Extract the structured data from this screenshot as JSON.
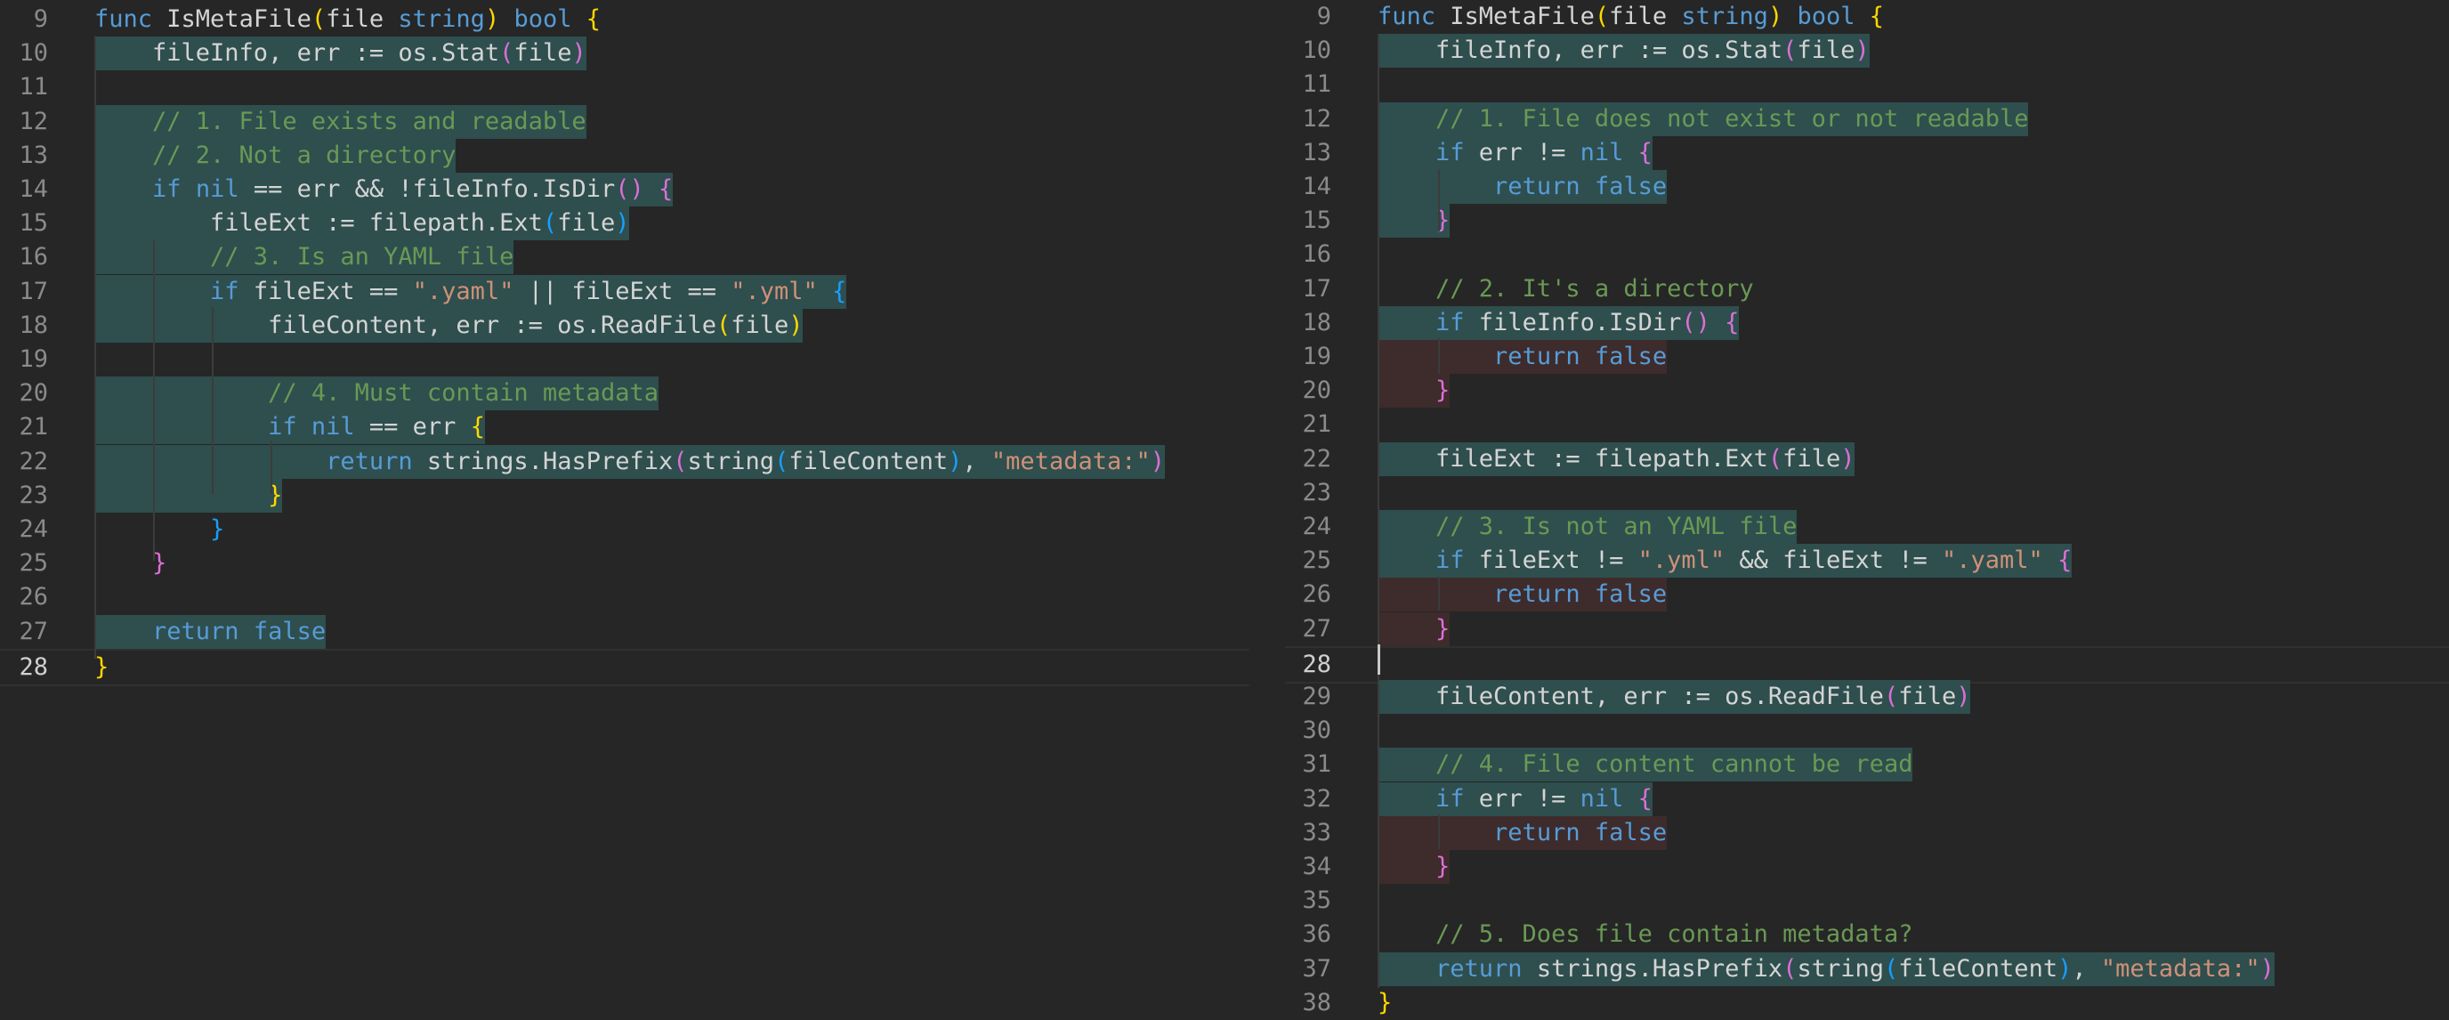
{
  "left_pane": {
    "lines": [
      {
        "n": "9",
        "tokens": [
          [
            "k",
            "func"
          ],
          [
            "p",
            " IsMetaFile"
          ],
          [
            "b1",
            "("
          ],
          [
            "p",
            "file "
          ],
          [
            "t",
            "string"
          ],
          [
            "b1",
            ")"
          ],
          [
            "p",
            " "
          ],
          [
            "t",
            "bool"
          ],
          [
            "p",
            " "
          ],
          [
            "b1",
            "{"
          ]
        ]
      },
      {
        "n": "10",
        "tokens": [
          [
            "p",
            "    fileInfo, err := os.Stat"
          ],
          [
            "b2",
            "("
          ],
          [
            "p",
            "file"
          ],
          [
            "b2",
            ")"
          ]
        ]
      },
      {
        "n": "11",
        "tokens": []
      },
      {
        "n": "12",
        "tokens": [
          [
            "c",
            "    // 1. File exists and readable"
          ]
        ]
      },
      {
        "n": "13",
        "tokens": [
          [
            "c",
            "    // 2. Not a directory"
          ]
        ]
      },
      {
        "n": "14",
        "tokens": [
          [
            "p",
            "    "
          ],
          [
            "k",
            "if"
          ],
          [
            "p",
            " "
          ],
          [
            "k",
            "nil"
          ],
          [
            "p",
            " == err && !fileInfo.IsDir"
          ],
          [
            "b2",
            "()"
          ],
          [
            "p",
            " "
          ],
          [
            "b2",
            "{"
          ]
        ]
      },
      {
        "n": "15",
        "tokens": [
          [
            "p",
            "        fileExt := filepath.Ext"
          ],
          [
            "b3",
            "("
          ],
          [
            "p",
            "file"
          ],
          [
            "b3",
            ")"
          ]
        ]
      },
      {
        "n": "16",
        "tokens": [
          [
            "c",
            "        // 3. Is an YAML file"
          ]
        ]
      },
      {
        "n": "17",
        "tokens": [
          [
            "p",
            "        "
          ],
          [
            "k",
            "if"
          ],
          [
            "p",
            " fileExt == "
          ],
          [
            "s",
            "\".yaml\""
          ],
          [
            "p",
            " || fileExt == "
          ],
          [
            "s",
            "\".yml\""
          ],
          [
            "p",
            " "
          ],
          [
            "b3",
            "{"
          ]
        ]
      },
      {
        "n": "18",
        "tokens": [
          [
            "p",
            "            fileContent, err := os.ReadFile"
          ],
          [
            "b1",
            "("
          ],
          [
            "p",
            "file"
          ],
          [
            "b1",
            ")"
          ]
        ]
      },
      {
        "n": "19",
        "tokens": []
      },
      {
        "n": "20",
        "tokens": [
          [
            "c",
            "            // 4. Must contain metadata"
          ]
        ]
      },
      {
        "n": "21",
        "tokens": [
          [
            "p",
            "            "
          ],
          [
            "k",
            "if"
          ],
          [
            "p",
            " "
          ],
          [
            "k",
            "nil"
          ],
          [
            "p",
            " == err "
          ],
          [
            "b1",
            "{"
          ]
        ]
      },
      {
        "n": "22",
        "tokens": [
          [
            "p",
            "                "
          ],
          [
            "k",
            "return"
          ],
          [
            "p",
            " strings.HasPrefix"
          ],
          [
            "b2",
            "("
          ],
          [
            "p",
            "string"
          ],
          [
            "b3",
            "("
          ],
          [
            "p",
            "fileContent"
          ],
          [
            "b3",
            ")"
          ],
          [
            "p",
            ", "
          ],
          [
            "s",
            "\"metadata:\""
          ],
          [
            "b2",
            ")"
          ]
        ]
      },
      {
        "n": "23",
        "tokens": [
          [
            "p",
            "            "
          ],
          [
            "b1",
            "}"
          ]
        ]
      },
      {
        "n": "24",
        "tokens": [
          [
            "p",
            "        "
          ],
          [
            "b3",
            "}"
          ]
        ]
      },
      {
        "n": "25",
        "tokens": [
          [
            "p",
            "    "
          ],
          [
            "b2",
            "}"
          ]
        ]
      },
      {
        "n": "26",
        "tokens": []
      },
      {
        "n": "27",
        "tokens": [
          [
            "p",
            "    "
          ],
          [
            "k",
            "return false"
          ]
        ]
      },
      {
        "n": "28",
        "tokens": [
          [
            "b1",
            "}"
          ]
        ]
      }
    ],
    "active_line": "28"
  },
  "right_pane": {
    "lines": [
      {
        "n": "9",
        "tokens": [
          [
            "k",
            "func"
          ],
          [
            "p",
            " IsMetaFile"
          ],
          [
            "b1",
            "("
          ],
          [
            "p",
            "file "
          ],
          [
            "t",
            "string"
          ],
          [
            "b1",
            ")"
          ],
          [
            "p",
            " "
          ],
          [
            "t",
            "bool"
          ],
          [
            "p",
            " "
          ],
          [
            "b1",
            "{"
          ]
        ]
      },
      {
        "n": "10",
        "tokens": [
          [
            "p",
            "    fileInfo, err := os.Stat"
          ],
          [
            "b2",
            "("
          ],
          [
            "p",
            "file"
          ],
          [
            "b2",
            ")"
          ]
        ]
      },
      {
        "n": "11",
        "tokens": []
      },
      {
        "n": "12",
        "tokens": [
          [
            "c",
            "    // 1. File does not exist or not readable"
          ]
        ]
      },
      {
        "n": "13",
        "tokens": [
          [
            "p",
            "    "
          ],
          [
            "k",
            "if"
          ],
          [
            "p",
            " err != "
          ],
          [
            "k",
            "nil"
          ],
          [
            "p",
            " "
          ],
          [
            "b2",
            "{"
          ]
        ]
      },
      {
        "n": "14",
        "tokens": [
          [
            "p",
            "        "
          ],
          [
            "k",
            "return false"
          ]
        ]
      },
      {
        "n": "15",
        "tokens": [
          [
            "p",
            "    "
          ],
          [
            "b2",
            "}"
          ]
        ]
      },
      {
        "n": "16",
        "tokens": []
      },
      {
        "n": "17",
        "tokens": [
          [
            "c",
            "    // 2. It's a directory"
          ]
        ]
      },
      {
        "n": "18",
        "tokens": [
          [
            "p",
            "    "
          ],
          [
            "k",
            "if"
          ],
          [
            "p",
            " fileInfo.IsDir"
          ],
          [
            "b2",
            "()"
          ],
          [
            "p",
            " "
          ],
          [
            "b2",
            "{"
          ]
        ]
      },
      {
        "n": "19",
        "tokens": [
          [
            "p",
            "        "
          ],
          [
            "k",
            "return false"
          ]
        ]
      },
      {
        "n": "20",
        "tokens": [
          [
            "p",
            "    "
          ],
          [
            "b2",
            "}"
          ]
        ]
      },
      {
        "n": "21",
        "tokens": []
      },
      {
        "n": "22",
        "tokens": [
          [
            "p",
            "    fileExt := filepath.Ext"
          ],
          [
            "b2",
            "("
          ],
          [
            "p",
            "file"
          ],
          [
            "b2",
            ")"
          ]
        ]
      },
      {
        "n": "23",
        "tokens": []
      },
      {
        "n": "24",
        "tokens": [
          [
            "c",
            "    // 3. Is not an YAML file"
          ]
        ]
      },
      {
        "n": "25",
        "tokens": [
          [
            "p",
            "    "
          ],
          [
            "k",
            "if"
          ],
          [
            "p",
            " fileExt != "
          ],
          [
            "s",
            "\".yml\""
          ],
          [
            "p",
            " && fileExt != "
          ],
          [
            "s",
            "\".yaml\""
          ],
          [
            "p",
            " "
          ],
          [
            "b2",
            "{"
          ]
        ]
      },
      {
        "n": "26",
        "tokens": [
          [
            "p",
            "        "
          ],
          [
            "k",
            "return false"
          ]
        ]
      },
      {
        "n": "27",
        "tokens": [
          [
            "p",
            "    "
          ],
          [
            "b2",
            "}"
          ]
        ]
      },
      {
        "n": "28",
        "tokens": []
      },
      {
        "n": "29",
        "tokens": [
          [
            "p",
            "    fileContent, err := os.ReadFile"
          ],
          [
            "b2",
            "("
          ],
          [
            "p",
            "file"
          ],
          [
            "b2",
            ")"
          ]
        ]
      },
      {
        "n": "30",
        "tokens": []
      },
      {
        "n": "31",
        "tokens": [
          [
            "c",
            "    // 4. File content cannot be read"
          ]
        ]
      },
      {
        "n": "32",
        "tokens": [
          [
            "p",
            "    "
          ],
          [
            "k",
            "if"
          ],
          [
            "p",
            " err != "
          ],
          [
            "k",
            "nil"
          ],
          [
            "p",
            " "
          ],
          [
            "b2",
            "{"
          ]
        ]
      },
      {
        "n": "33",
        "tokens": [
          [
            "p",
            "        "
          ],
          [
            "k",
            "return false"
          ]
        ]
      },
      {
        "n": "34",
        "tokens": [
          [
            "p",
            "    "
          ],
          [
            "b2",
            "}"
          ]
        ]
      },
      {
        "n": "35",
        "tokens": []
      },
      {
        "n": "36",
        "tokens": [
          [
            "c",
            "    // 5. Does file contain metadata?"
          ]
        ]
      },
      {
        "n": "37",
        "tokens": [
          [
            "p",
            "    "
          ],
          [
            "k",
            "return"
          ],
          [
            "p",
            " strings.HasPrefix"
          ],
          [
            "b2",
            "("
          ],
          [
            "p",
            "string"
          ],
          [
            "b3",
            "("
          ],
          [
            "p",
            "fileContent"
          ],
          [
            "b3",
            ")"
          ],
          [
            "p",
            ", "
          ],
          [
            "s",
            "\"metadata:\""
          ],
          [
            "b2",
            ")"
          ]
        ]
      },
      {
        "n": "38",
        "tokens": [
          [
            "b1",
            "}"
          ]
        ]
      }
    ],
    "active_line": "28"
  },
  "colors": {
    "background": "#262626",
    "inserted_highlight": "#2f4e4e",
    "removed_highlight": "#3e2b2b",
    "keyword": "#569cd6",
    "string": "#ce9178",
    "comment": "#6a9955"
  }
}
